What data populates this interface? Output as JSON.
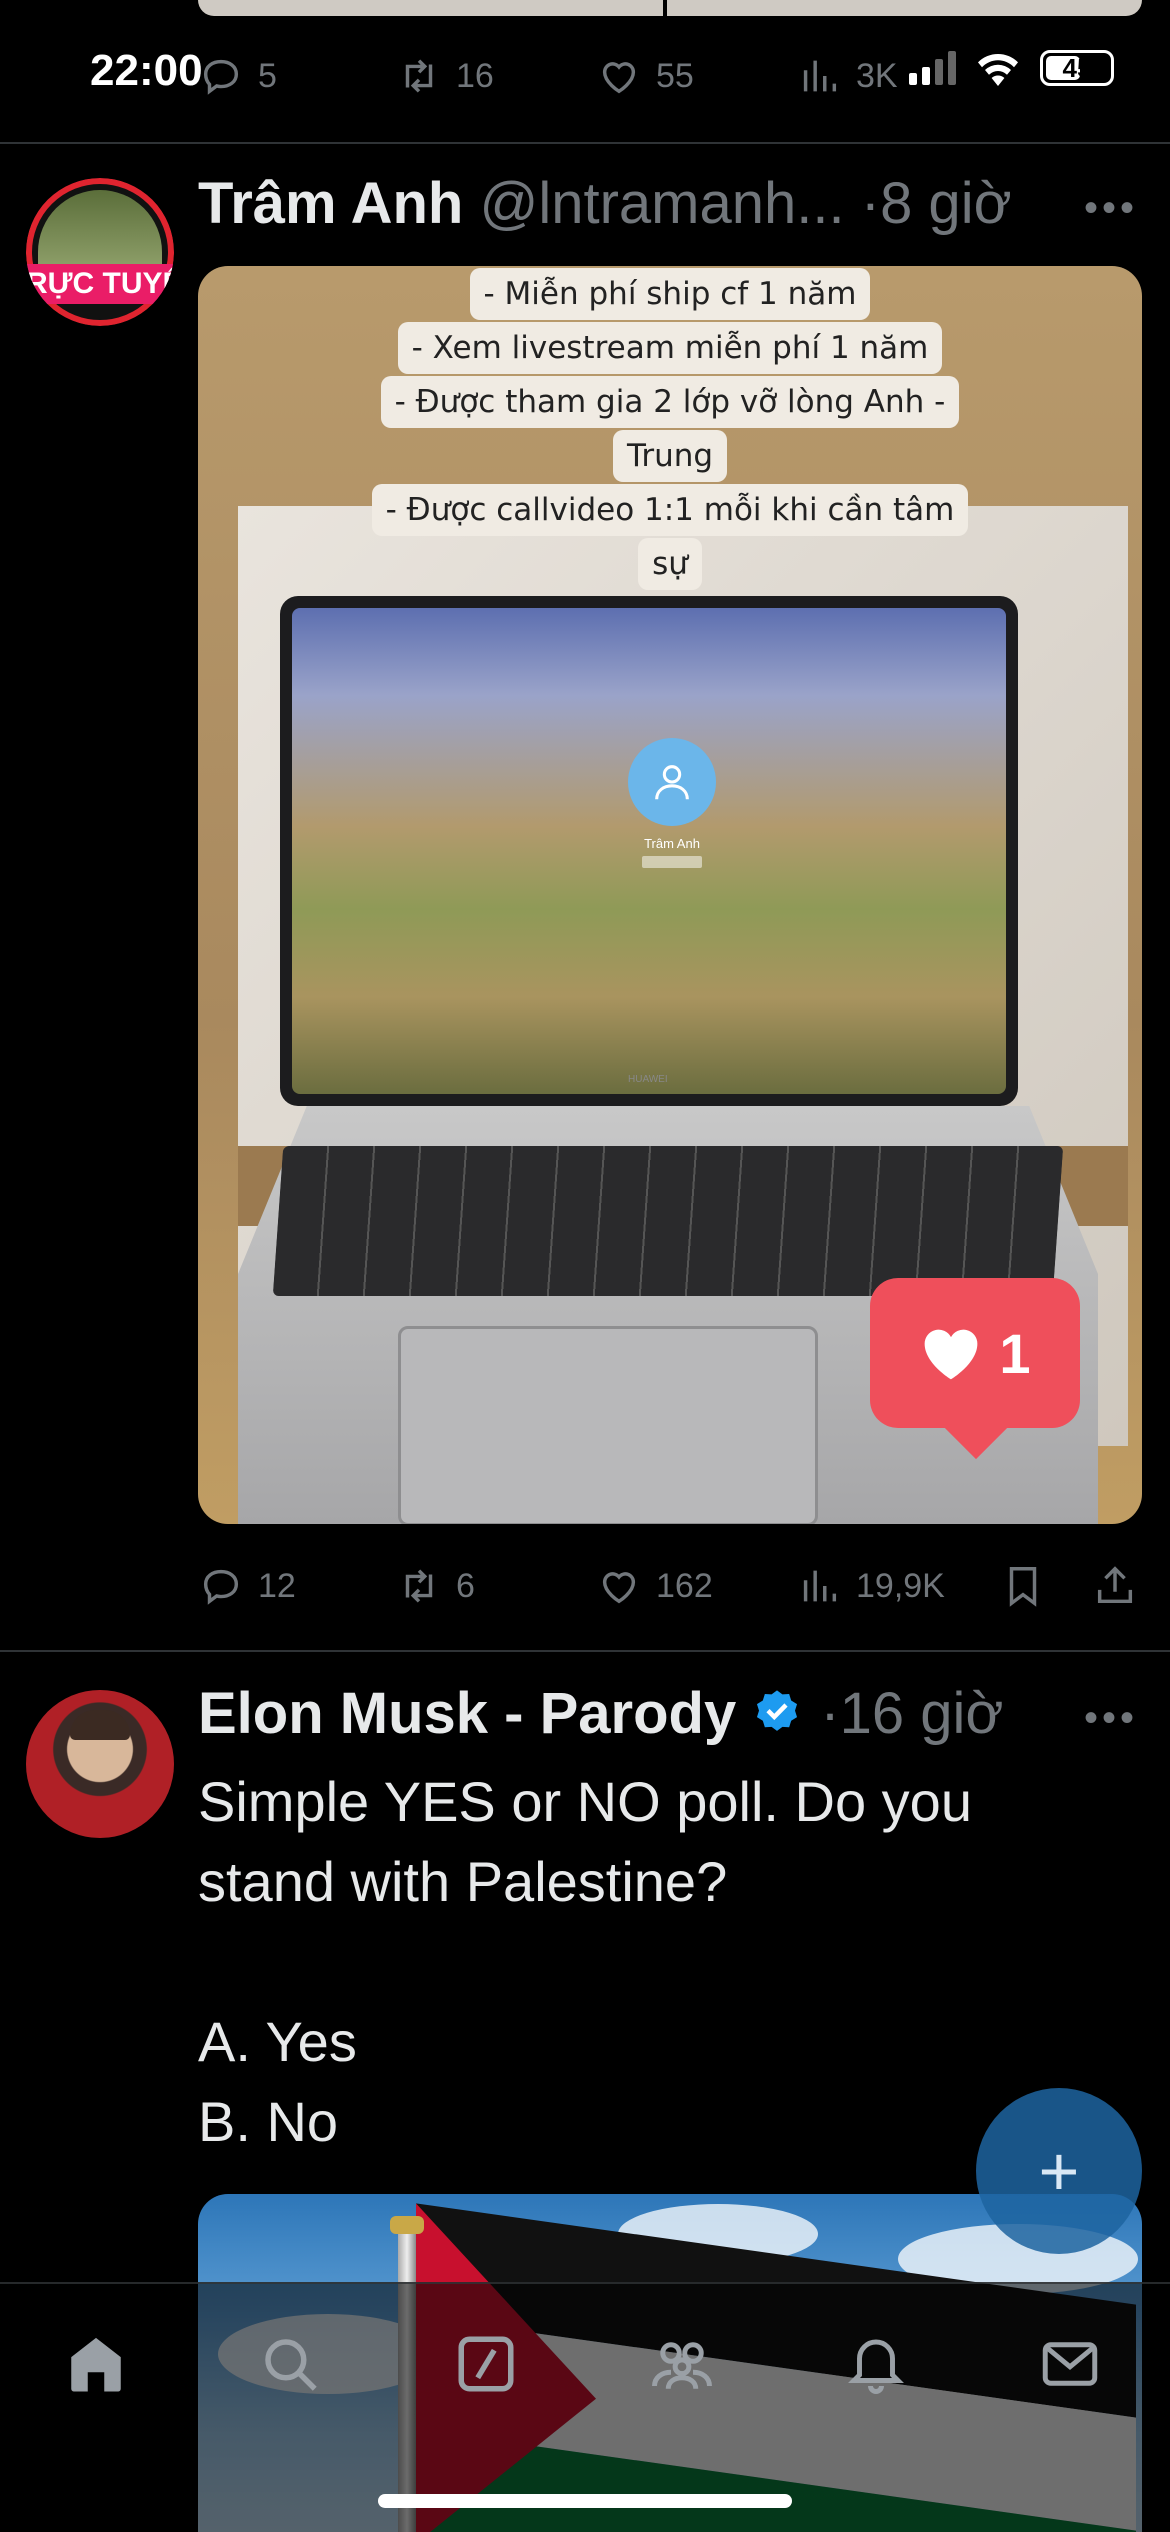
{
  "status_bar": {
    "time": "22:00",
    "battery": "45"
  },
  "prev_tweet_actions": {
    "replies": "5",
    "retweets": "16",
    "likes": "55",
    "views": "3K"
  },
  "tweet1": {
    "name": "Trâm Anh",
    "handle": "@lntramanh...",
    "dot": "·",
    "time": "8 giờ",
    "avatar_badge": "RỰC TUYẾ",
    "media_captions": [
      "- Miễn phí ship cf 1 năm",
      "- Xem livestream miễn phí 1 năm",
      "- Được tham gia 2 lớp vỡ lòng Anh -",
      "Trung",
      "- Được callvideo 1:1 mỗi khi cần tâm",
      "sự"
    ],
    "screen_user_name": "Trâm Anh",
    "laptop_brand": "HUAWEI",
    "like_bubble_count": "1",
    "actions": {
      "replies": "12",
      "retweets": "6",
      "likes": "162",
      "views": "19,9K"
    }
  },
  "tweet2": {
    "name": "Elon Musk - Parody",
    "dot": "·",
    "time": "16 giờ",
    "body": "Simple YES or NO poll. Do you\nstand with Palestine?\n\nA. Yes\nB. No"
  },
  "fab_icon": "plus-icon",
  "tabs": [
    "home-icon",
    "search-icon",
    "grok-icon",
    "communities-icon",
    "notifications-icon",
    "messages-icon"
  ],
  "colors": {
    "accent": "#1d9bf0",
    "background": "#000000",
    "secondary_text": "#71767b",
    "like_bubble": "#ef4f5b"
  }
}
